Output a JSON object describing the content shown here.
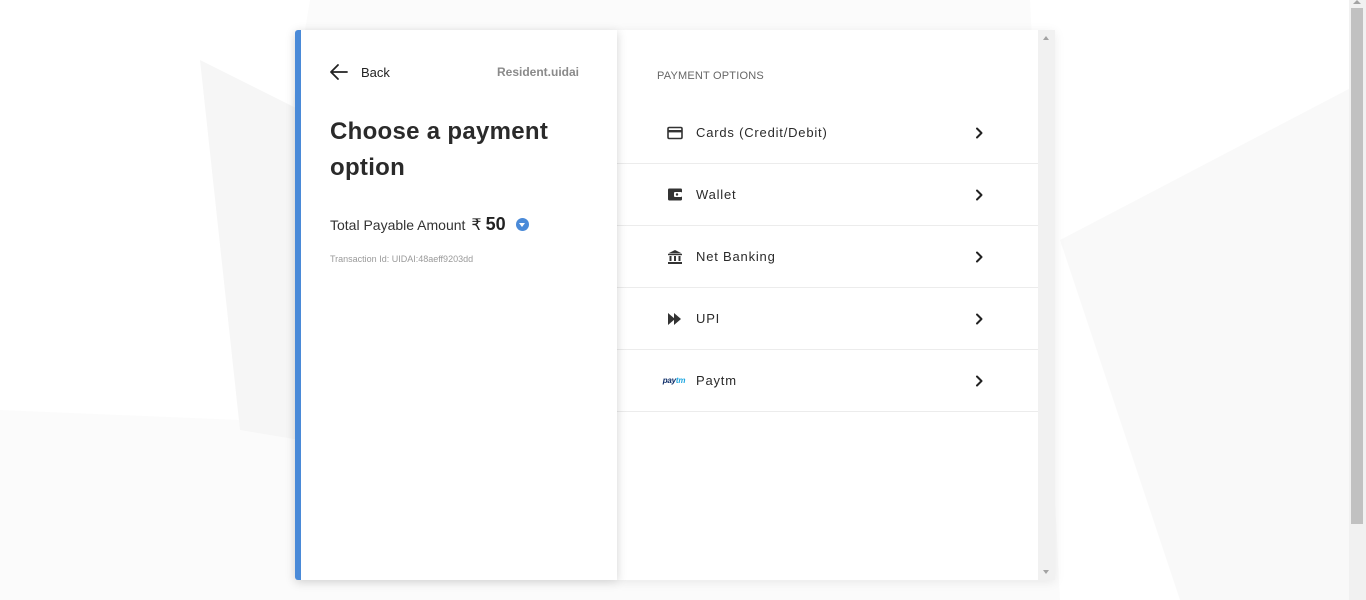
{
  "header": {
    "back_label": "Back",
    "merchant": "Resident.uidai"
  },
  "summary": {
    "title": "Choose a payment option",
    "amount_label": "Total Payable Amount",
    "currency_symbol": "₹",
    "amount_value": "50",
    "transaction_id": "Transaction Id: UIDAI:48aeff9203dd"
  },
  "options": {
    "header": "PAYMENT OPTIONS",
    "items": [
      {
        "label": "Cards (Credit/Debit)",
        "icon": "card-icon"
      },
      {
        "label": "Wallet",
        "icon": "wallet-icon"
      },
      {
        "label": "Net Banking",
        "icon": "bank-icon"
      },
      {
        "label": "UPI",
        "icon": "upi-icon"
      },
      {
        "label": "Paytm",
        "icon": "paytm-logo"
      }
    ]
  },
  "paytm_logo": {
    "pay": "pay",
    "tm": "tm"
  },
  "colors": {
    "accent": "#4a8ad8",
    "text_primary": "#2a2a2a",
    "text_muted": "#9a9a9a"
  }
}
